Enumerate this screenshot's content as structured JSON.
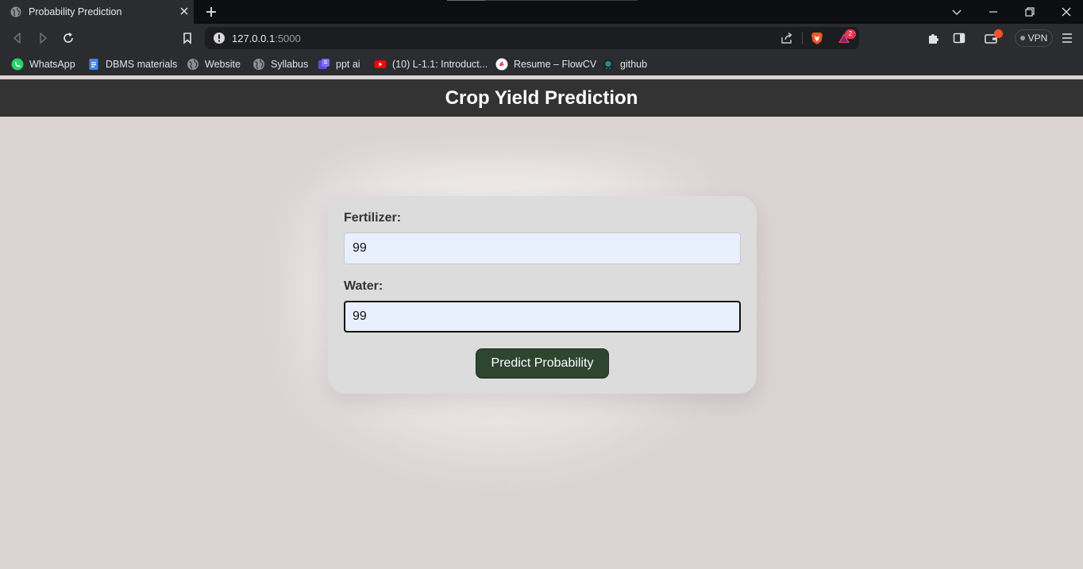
{
  "browser": {
    "tab": {
      "title": "Probability Prediction"
    },
    "address": {
      "host": "127.0.0.1",
      "port": ":5000"
    },
    "vpn_label": "VPN",
    "notification_count": "2",
    "bookmarks": [
      {
        "label": "WhatsApp",
        "icon": "whatsapp-icon"
      },
      {
        "label": "DBMS materials",
        "icon": "docs-icon"
      },
      {
        "label": "Website",
        "icon": "globe-icon"
      },
      {
        "label": "Syllabus",
        "icon": "globe-icon"
      },
      {
        "label": "ppt ai",
        "icon": "ppt-ai-icon"
      },
      {
        "label": "(10) L-1.1: Introduct...",
        "icon": "youtube-icon"
      },
      {
        "label": "Resume – FlowCV",
        "icon": "flowcv-icon"
      },
      {
        "label": "github",
        "icon": "github-icon"
      }
    ],
    "colors": {
      "tabstrip": "#0d0e11",
      "toolbar": "#2b2c30",
      "omnibox": "#1c1d21",
      "brave_orange": "#fb542b"
    }
  },
  "page": {
    "title": "Crop Yield Prediction",
    "form": {
      "fertilizer": {
        "label": "Fertilizer:",
        "value": "99"
      },
      "water": {
        "label": "Water:",
        "value": "99"
      },
      "submit_label": "Predict Probability"
    },
    "colors": {
      "header_bg": "#333333",
      "page_bg": "#dcd3d3",
      "card_bg": "#dddcdc",
      "button_bg": "#2e4530",
      "input_bg": "#e8f0fe"
    }
  }
}
